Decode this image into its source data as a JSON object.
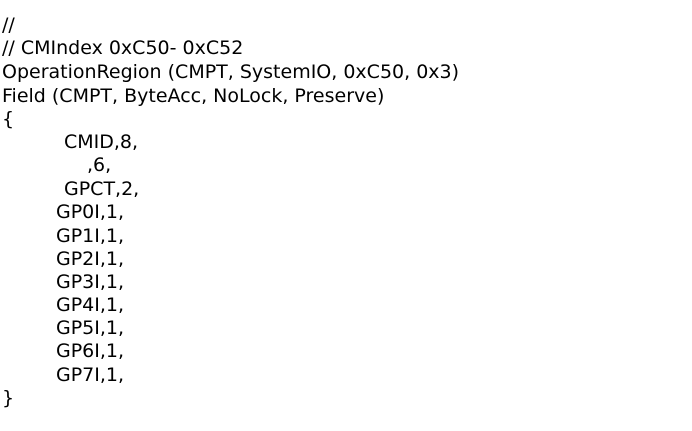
{
  "code": {
    "lines": [
      "//",
      "// CMIndex 0xC50- 0xC52",
      "OperationRegion (CMPT, SystemIO, 0xC50, 0x3)",
      "Field (CMPT, ByteAcc, NoLock, Preserve)",
      "{",
      "CMID,8,",
      ",6,",
      "GPCT,2,",
      "GP0I,1,",
      "GP1I,1,",
      "GP2I,1,",
      "GP3I,1,",
      "GP4I,1,",
      "GP5I,1,",
      "GP6I,1,",
      "GP7I,1,",
      "}"
    ]
  }
}
